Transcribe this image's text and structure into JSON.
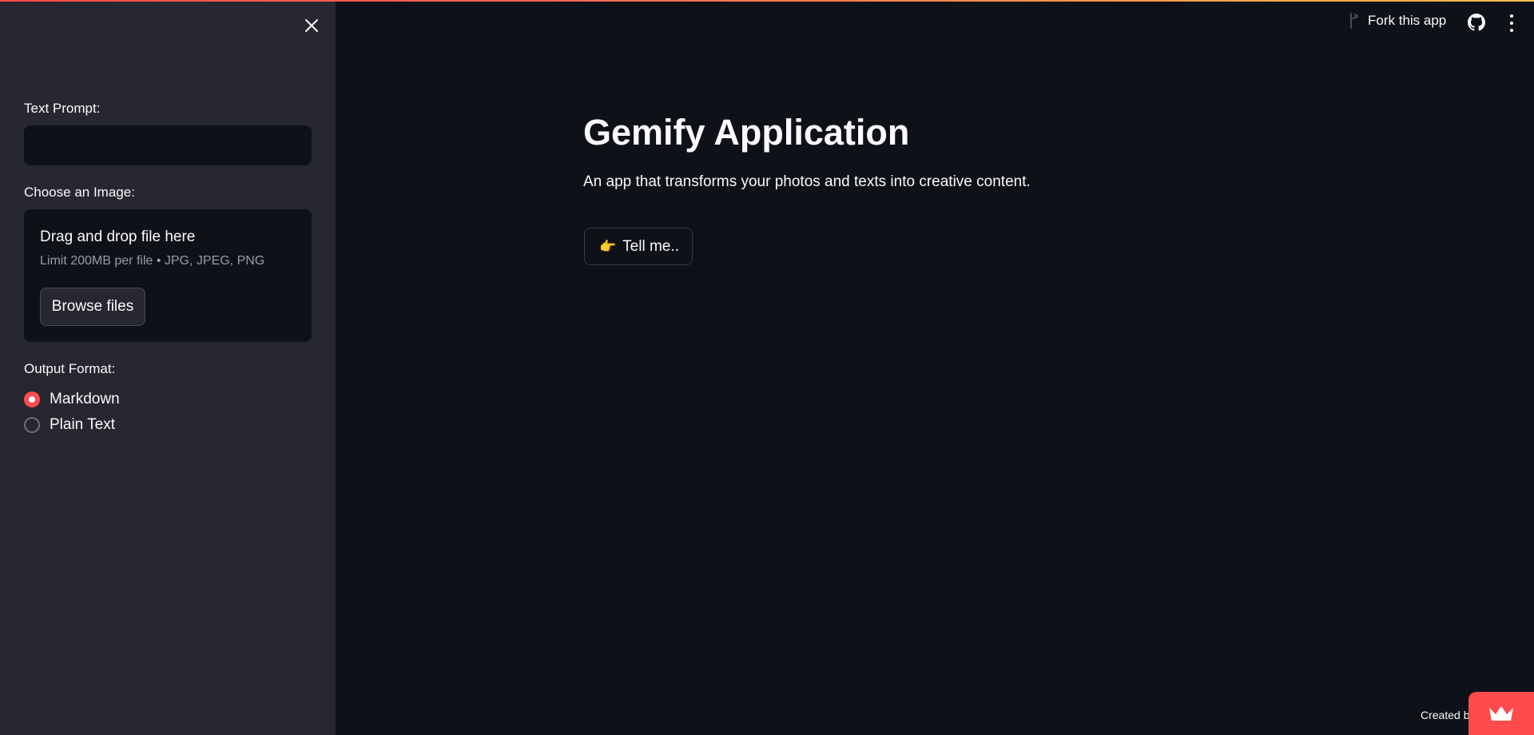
{
  "colors": {
    "accent": "#ff4b4b",
    "background": "#0e1117",
    "sidebar_background": "#262730",
    "text": "#fafafa",
    "muted_text": "#9a9ca3"
  },
  "sidebar": {
    "close_icon": "close-icon",
    "text_prompt": {
      "label": "Text Prompt:",
      "value": "",
      "placeholder": ""
    },
    "image_upload": {
      "label": "Choose an Image:",
      "drop_title": "Drag and drop file here",
      "drop_hint": "Limit 200MB per file • JPG, JPEG, PNG",
      "browse_label": "Browse files"
    },
    "output_format": {
      "label": "Output Format:",
      "options": [
        {
          "label": "Markdown",
          "selected": true
        },
        {
          "label": "Plain Text",
          "selected": false
        }
      ]
    }
  },
  "toolbar": {
    "fork_label": "Fork this app",
    "fork_icon": "fork-icon",
    "github_icon": "github-icon",
    "menu_icon": "kebab-menu-icon"
  },
  "main": {
    "title": "Gemify Application",
    "subtitle": "An app that transforms your photos and texts into creative content.",
    "action_button": {
      "icon": "👉",
      "label": "Tell me.."
    }
  },
  "footer": {
    "created_by": "Created b",
    "badge_icon": "crown-icon"
  }
}
